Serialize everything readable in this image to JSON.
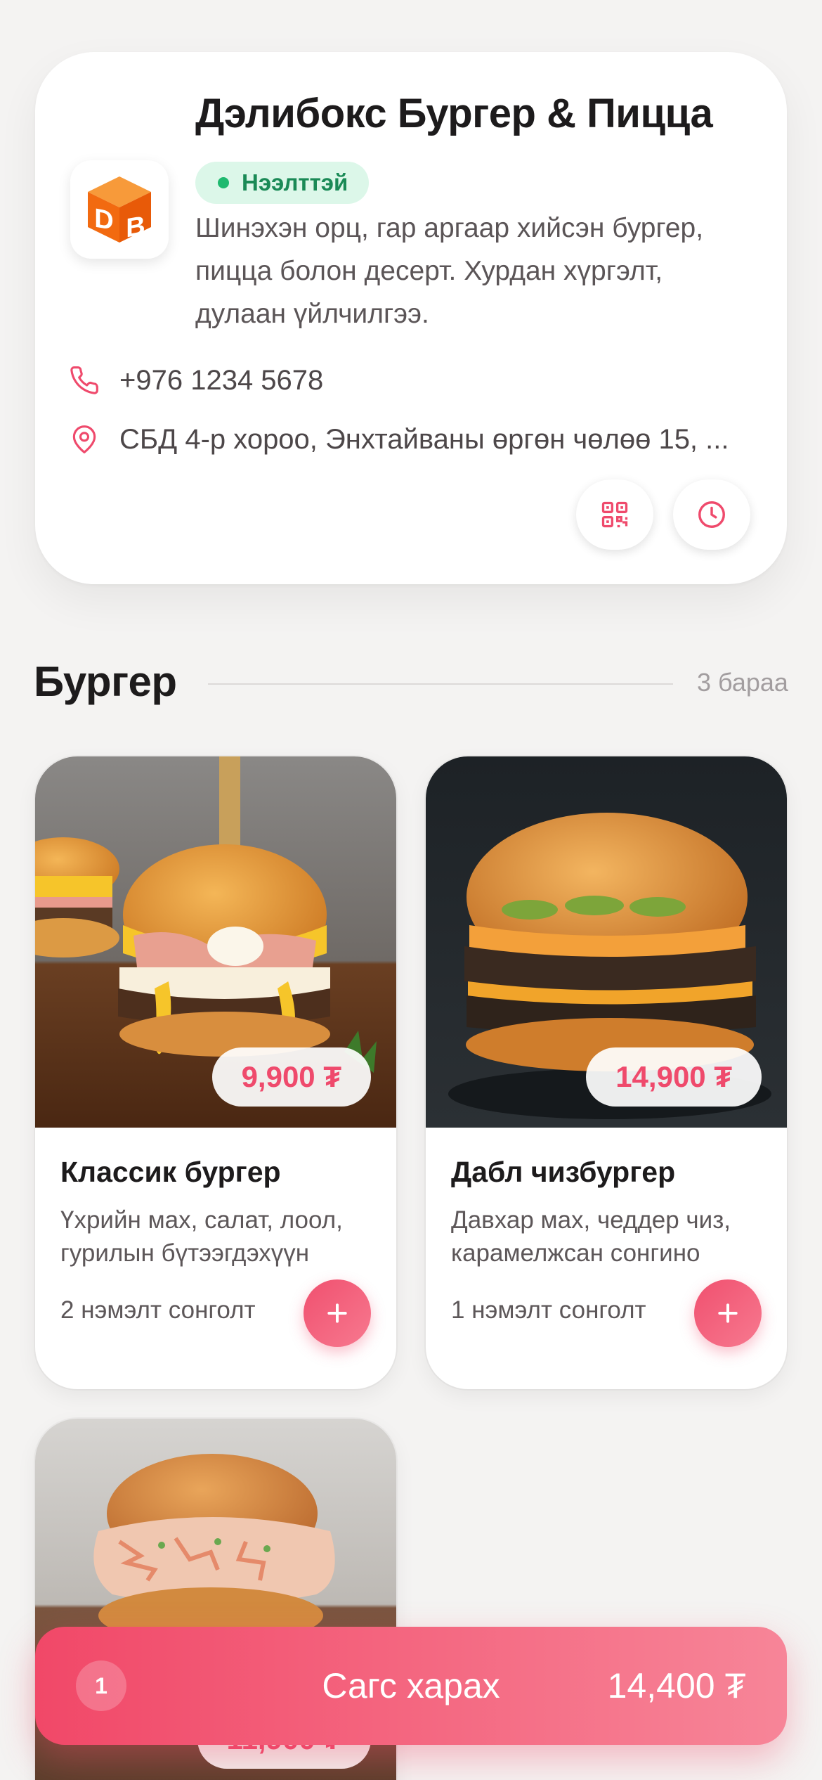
{
  "restaurant": {
    "name": "Дэлибокс Бургер & Пицца",
    "logo_text": "DB",
    "status": "Нээлттэй",
    "description": "Шинэхэн орц, гар аргаар хийсэн бургер, пицца болон десерт. Хурдан хүргэлт, дулаан үйлчилгээ.",
    "phone": "+976 1234 5678",
    "address": "СБД 4-р хороо, Энхтайваны өргөн чөлөө 15, ..."
  },
  "section": {
    "title": "Бургер",
    "count": "3 бараа"
  },
  "products": [
    {
      "name": "Классик бургер",
      "description": "Үхрийн мах, салат, лоол, гурилын бүтээгдэхүүн",
      "price": "9,900 ₮",
      "options": "2 нэмэлт сонголт"
    },
    {
      "name": "Дабл чизбургер",
      "description": "Давхар мах, чеддер чиз, карамелжсан сонгино",
      "price": "14,900 ₮",
      "options": "1 нэмэлт сонголт"
    },
    {
      "price": "11,900 ₮"
    }
  ],
  "cart": {
    "count": "1",
    "label": "Сагс харах",
    "total": "14,400 ₮"
  },
  "colors": {
    "accent": "#ef4a6c",
    "status_green": "#1fb96f",
    "logo_orange": "#f26a10"
  },
  "icons": {
    "phone": "phone-icon",
    "location": "map-pin-icon",
    "qr": "qr-code-icon",
    "hours": "clock-icon",
    "add": "plus-icon"
  }
}
